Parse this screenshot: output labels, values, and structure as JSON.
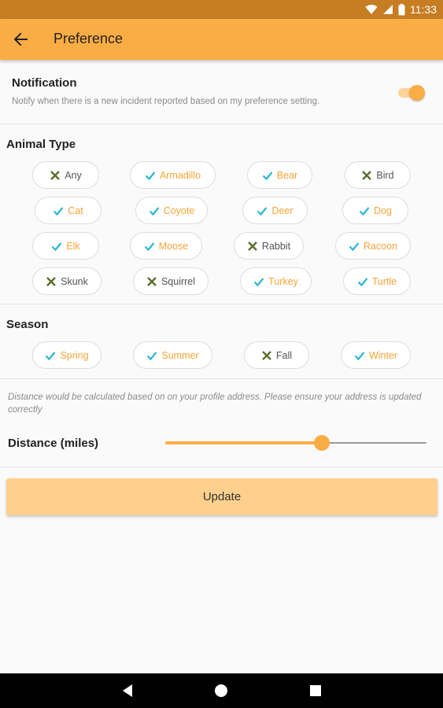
{
  "status_bar": {
    "time": "11:33"
  },
  "app_bar": {
    "title": "Preference"
  },
  "notification": {
    "title": "Notification",
    "description": "Notify when there is a new incident reported based on my preference setting.",
    "enabled": true
  },
  "animal_type": {
    "title": "Animal Type",
    "chips": [
      {
        "label": "Any",
        "selected": false
      },
      {
        "label": "Armadillo",
        "selected": true
      },
      {
        "label": "Bear",
        "selected": true
      },
      {
        "label": "Bird",
        "selected": false
      },
      {
        "label": "Cat",
        "selected": true
      },
      {
        "label": "Coyote",
        "selected": true
      },
      {
        "label": "Deer",
        "selected": true
      },
      {
        "label": "Dog",
        "selected": true
      },
      {
        "label": "Elk",
        "selected": true
      },
      {
        "label": "Moose",
        "selected": true
      },
      {
        "label": "Rabbit",
        "selected": false
      },
      {
        "label": "Racoon",
        "selected": true
      },
      {
        "label": "Skunk",
        "selected": false
      },
      {
        "label": "Squirrel",
        "selected": false
      },
      {
        "label": "Turkey",
        "selected": true
      },
      {
        "label": "Turtle",
        "selected": true
      }
    ]
  },
  "season": {
    "title": "Season",
    "chips": [
      {
        "label": "Spring",
        "selected": true
      },
      {
        "label": "Summer",
        "selected": true
      },
      {
        "label": "Fall",
        "selected": false
      },
      {
        "label": "Winter",
        "selected": true
      }
    ]
  },
  "distance": {
    "note": "Distance would be calculated based on on your profile address. Please ensure your address is updated correctly",
    "label": "Distance (miles)",
    "fraction": 0.6
  },
  "update_button": {
    "label": "Update"
  },
  "colors": {
    "accent": "#fbad45",
    "selected_text": "#f7a437",
    "check_icon": "#29b6d6",
    "cross_icon": "#5a6e2e",
    "status_bar": "#c77d22"
  }
}
